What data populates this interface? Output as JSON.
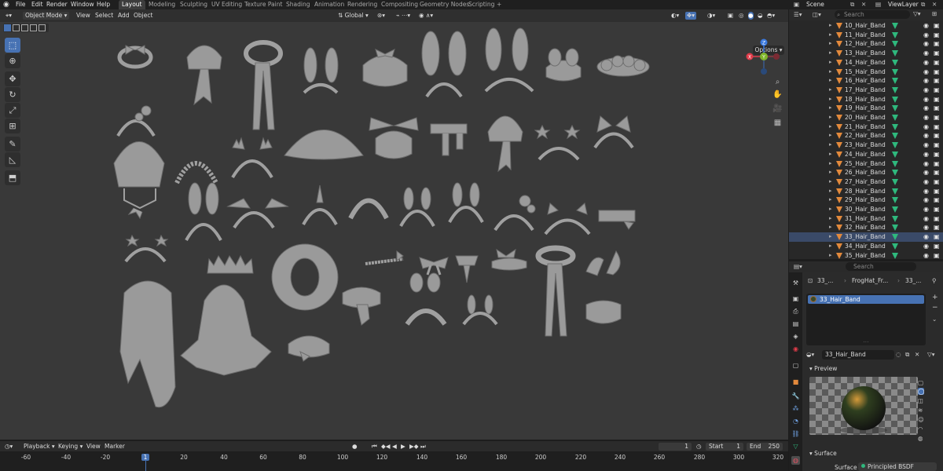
{
  "menu": [
    "File",
    "Edit",
    "Render",
    "Window",
    "Help"
  ],
  "workspaces": [
    "Layout",
    "Modeling",
    "Sculpting",
    "UV Editing",
    "Texture Paint",
    "Shading",
    "Animation",
    "Rendering",
    "Compositing",
    "Geometry Nodes",
    "Scripting"
  ],
  "workspace_add": "+",
  "scene": "Scene",
  "view_layer": "ViewLayer",
  "viewport_header": {
    "mode": "Object Mode",
    "menus": [
      "View",
      "Select",
      "Add",
      "Object"
    ],
    "orientation": "Global",
    "options": "Options"
  },
  "gizmo": {
    "x": "X",
    "y": "Y",
    "z": "Z"
  },
  "timeline": {
    "menus": [
      "Playback",
      "Keying",
      "View",
      "Marker"
    ],
    "current_frame": "1",
    "start_label": "Start",
    "start": "1",
    "end_label": "End",
    "end": "250",
    "ticks": [
      "-60",
      "-40",
      "-20",
      "1",
      "20",
      "40",
      "60",
      "80",
      "100",
      "120",
      "140",
      "160",
      "180",
      "200",
      "220",
      "240",
      "260",
      "280",
      "300",
      "320"
    ]
  },
  "outliner": {
    "search": "Search",
    "items": [
      "10_Hair_Band",
      "11_Hair_Band",
      "12_Hair_Band",
      "13_Hair_Band",
      "14_Hair_Band",
      "15_Hair_Band",
      "16_Hair_Band",
      "17_Hair_Band",
      "18_Hair_Band",
      "19_Hair_Band",
      "20_Hair_Band",
      "21_Hair_Band",
      "22_Hair_Band",
      "23_Hair_Band",
      "24_Hair_Band",
      "25_Hair_Band",
      "26_Hair_Band",
      "27_Hair_Band",
      "28_Hair_Band",
      "29_Hair_Band",
      "30_Hair_Band",
      "31_Hair_Band",
      "32_Hair_Band",
      "33_Hair_Band",
      "34_Hair_Band",
      "35_Hair_Band"
    ],
    "selected_index": 23
  },
  "properties": {
    "search": "Search",
    "breadcrumb": [
      "33_...",
      "FrogHat_Fr...",
      "33_..."
    ],
    "slot": "33_Hair_Band",
    "material_name": "33_Hair_Band",
    "preview_label": "Preview",
    "surface_label": "Surface",
    "surface_key": "Surface",
    "surface_value": "Principled BSDF"
  },
  "colors": {
    "accent": "#4772b3",
    "x_axis": "#e03c4a",
    "y_axis": "#7fb52b",
    "z_axis": "#3c7be0",
    "mesh_icon": "#e2893c",
    "material_icon": "#2fb87d"
  }
}
